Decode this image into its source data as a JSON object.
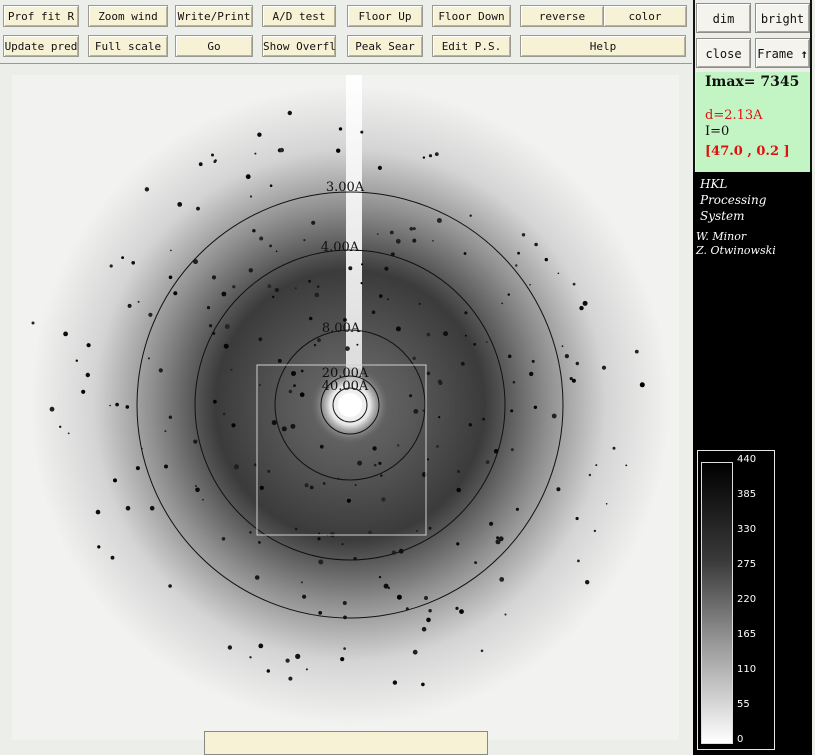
{
  "toolbar": {
    "row1": [
      "Prof fit R",
      "Zoom wind",
      "Write/Print",
      "A/D test",
      "Floor Up",
      "Floor Down",
      "reverse",
      "color"
    ],
    "row2": [
      "Update pred",
      "Full scale",
      "Go",
      "Show Overfl",
      "Peak Sear",
      "Edit P.S.",
      "Help"
    ]
  },
  "side_buttons": {
    "dim": "dim",
    "bright": "bright",
    "close": "close",
    "frame": "Frame"
  },
  "info": {
    "imax": "Imax= 7345",
    "d": "d=2.13A",
    "i": "I=0",
    "coord": "[47.0 , 0.2 ]"
  },
  "credits": {
    "line1": "HKL",
    "line2": "Processing",
    "line3": "System",
    "author1": "W. Minor",
    "author2": "Z. Otwinowski"
  },
  "resolution_rings": [
    "3.00A",
    "4.00A",
    "8.00A",
    "20.00A",
    "40.00A"
  ],
  "intensity_scale": [
    "440",
    "385",
    "330",
    "275",
    "220",
    "165",
    "110",
    "55",
    "0"
  ],
  "colors": {
    "button_bg": "#f7f2d6",
    "info_bg": "#c3f4c3",
    "highlight_text": "#e01010"
  }
}
